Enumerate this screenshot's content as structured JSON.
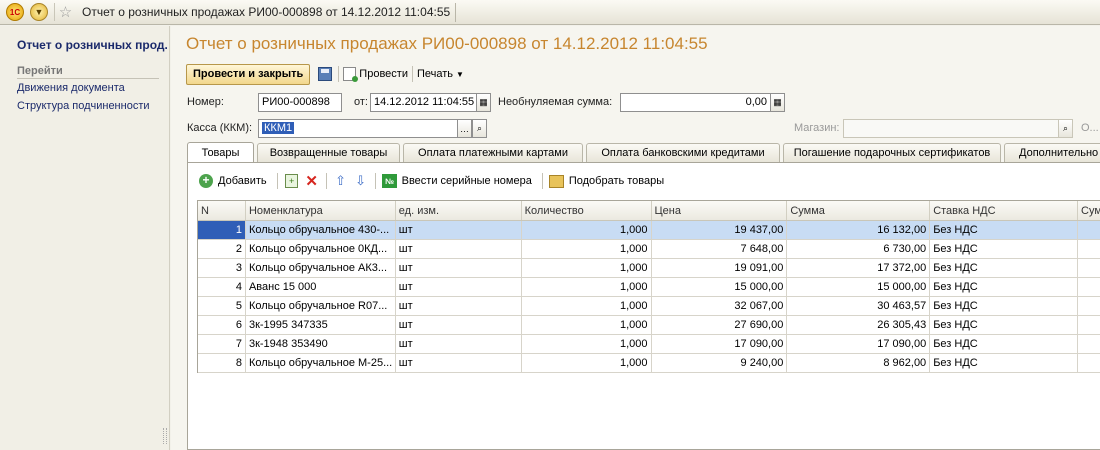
{
  "window": {
    "title": "Отчет о розничных продажах РИ00-000898 от 14.12.2012 11:04:55",
    "logo": "1С"
  },
  "sidebar": {
    "title": "Отчет о розничных прод...",
    "section": "Перейти",
    "links": [
      "Движения документа",
      "Структура подчиненности"
    ]
  },
  "document": {
    "title": "Отчет о розничных продажах РИ00-000898 от 14.12.2012 11:04:55"
  },
  "toolbar": {
    "post_close": "Провести и закрыть",
    "post": "Провести",
    "print": "Печать"
  },
  "form": {
    "number_label": "Номер:",
    "number_value": "РИ00-000898",
    "date_label": "от:",
    "date_value": "14.12.2012 11:04:55",
    "balance_label": "Необнуляемая сумма:",
    "balance_value": "0,00",
    "kassa_label": "Касса (ККМ):",
    "kassa_value": "ККМ1",
    "store_label": "Магазин:",
    "store_value": "",
    "store_ellipsis": "О..."
  },
  "tabs": [
    "Товары",
    "Возвращенные товары",
    "Оплата платежными картами",
    "Оплата банковскими кредитами",
    "Погашение подарочных сертификатов",
    "Дополнительно"
  ],
  "table_toolbar": {
    "add": "Добавить",
    "serial": "Ввести серийные номера",
    "serial_icon": "№",
    "pick": "Подобрать товары"
  },
  "table": {
    "headers": [
      "N",
      "Номенклатура",
      "ед. изм.",
      "Количество",
      "Цена",
      "Сумма",
      "Ставка НДС",
      "Сумм"
    ],
    "rows": [
      [
        "1",
        "Кольцо обручальное 430-...",
        "шт",
        "1,000",
        "19 437,00",
        "16 132,00",
        "Без НДС"
      ],
      [
        "2",
        "Кольцо обручальное 0КД...",
        "шт",
        "1,000",
        "7 648,00",
        "6 730,00",
        "Без НДС"
      ],
      [
        "3",
        "Кольцо обручальное АК3...",
        "шт",
        "1,000",
        "19 091,00",
        "17 372,00",
        "Без НДС"
      ],
      [
        "4",
        "Аванс 15 000",
        "шт",
        "1,000",
        "15 000,00",
        "15 000,00",
        "Без НДС"
      ],
      [
        "5",
        "Кольцо обручальное R07...",
        "шт",
        "1,000",
        "32 067,00",
        "30 463,57",
        "Без НДС"
      ],
      [
        "6",
        "3к-1995 347335",
        "шт",
        "1,000",
        "27 690,00",
        "26 305,43",
        "Без НДС"
      ],
      [
        "7",
        "3к-1948 353490",
        "шт",
        "1,000",
        "17 090,00",
        "17 090,00",
        "Без НДС"
      ],
      [
        "8",
        "Кольцо обручальное М-25...",
        "шт",
        "1,000",
        "9 240,00",
        "8 962,00",
        "Без НДС"
      ]
    ]
  },
  "colors": {
    "title": "#c7862f",
    "link": "#1b2a6b",
    "selection": "#2f5eb7"
  }
}
